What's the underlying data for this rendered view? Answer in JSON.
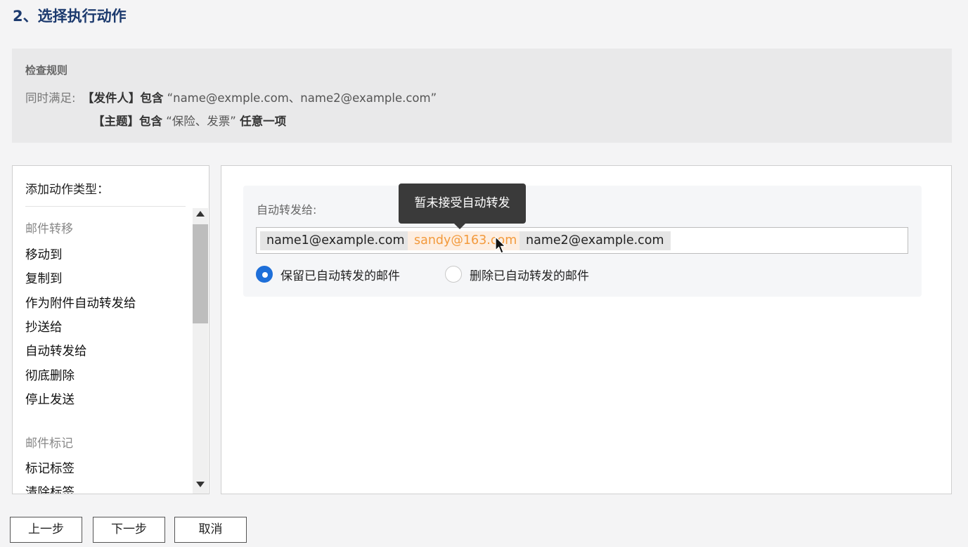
{
  "page": {
    "title": "2、选择执行动作"
  },
  "rule": {
    "heading": "检查规则",
    "prefix": "同时满足:",
    "line1": {
      "field": "【发件人】包含",
      "value": "“name@exmple.com、name2@example.com”"
    },
    "line2": {
      "field": "【主题】包含",
      "value": "“保险、发票”",
      "suffix": "任意一项"
    }
  },
  "action_types": {
    "title": "添加动作类型：",
    "groups": [
      {
        "label": "邮件转移",
        "items": [
          "移动到",
          "复制到",
          "作为附件自动转发给",
          "抄送给",
          "自动转发给",
          "彻底删除",
          "停止发送"
        ]
      },
      {
        "label": "邮件标记",
        "items": [
          "标记标签",
          "清除标签"
        ]
      }
    ]
  },
  "forward": {
    "label": "自动转发给:",
    "recipients": [
      {
        "email": "name1@example.com",
        "status": "normal"
      },
      {
        "email": "sandy@163.com",
        "status": "warning"
      },
      {
        "email": "name2@example.com",
        "status": "normal"
      }
    ],
    "options": [
      {
        "label": "保留已自动转发的邮件",
        "checked": true
      },
      {
        "label": "删除已自动转发的邮件",
        "checked": false
      }
    ]
  },
  "tooltip": {
    "text": "暂未接受自动转发"
  },
  "buttons": {
    "prev": "上一步",
    "next": "下一步",
    "cancel": "取消"
  },
  "colors": {
    "title": "#1c3a6e",
    "accent": "#1e6fd9",
    "warning_text": "#f39a3c",
    "warning_bg": "#fdeee1"
  }
}
